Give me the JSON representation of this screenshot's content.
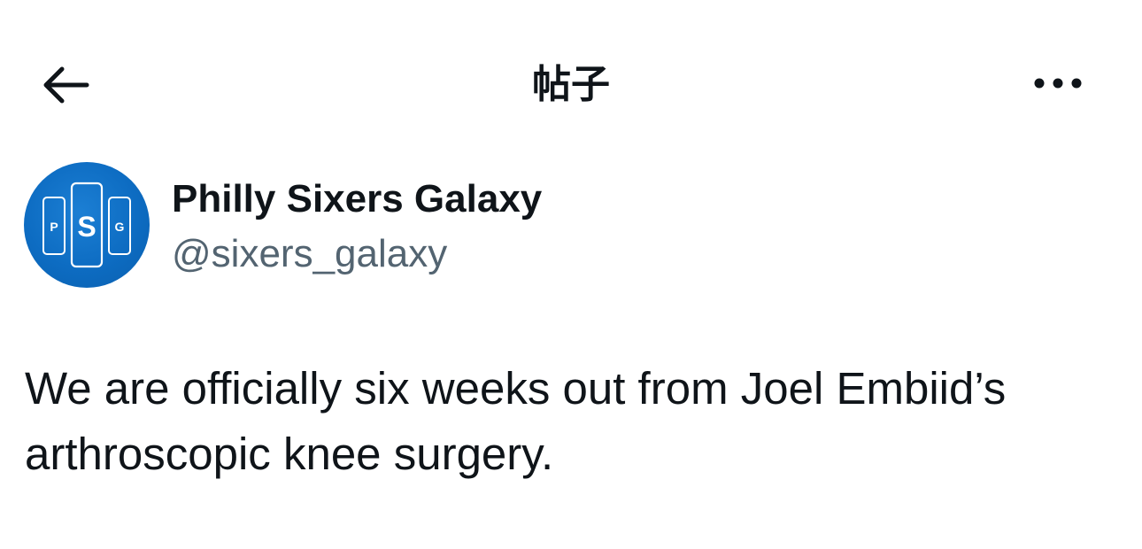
{
  "header": {
    "title": "帖子",
    "back_icon": "arrow-left-icon",
    "more_icon": "more-horizontal-icon"
  },
  "author": {
    "display_name": "Philly Sixers Galaxy",
    "handle": "@sixers_galaxy",
    "avatar": {
      "letters": [
        "P",
        "S",
        "G"
      ],
      "background_color": "#0d6cc2",
      "foreground_color": "#ffffff"
    }
  },
  "post": {
    "text": "We are officially six weeks out from Joel Embiid’s arthroscopic knee surgery."
  },
  "colors": {
    "text_primary": "#0f1419",
    "text_secondary": "#536471",
    "background": "#ffffff"
  }
}
